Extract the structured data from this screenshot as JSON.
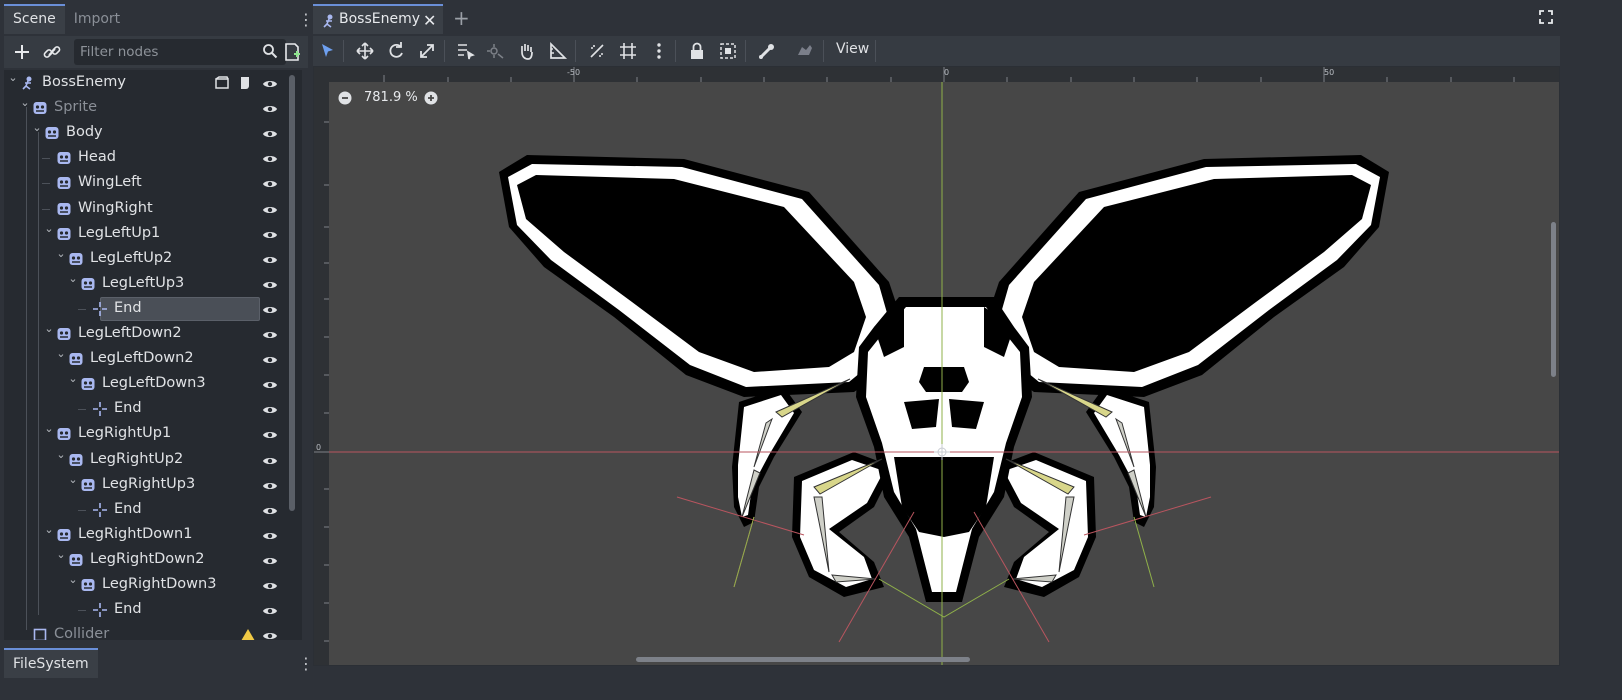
{
  "left_dock": {
    "tabs": [
      {
        "label": "Scene",
        "active": true
      },
      {
        "label": "Import",
        "active": false
      }
    ],
    "toolbar": {
      "add_icon": "plus-icon",
      "link_icon": "link-icon",
      "filter_placeholder": "Filter nodes",
      "search_icon": "search-icon",
      "script_icon": "add-script-icon"
    },
    "tree": [
      {
        "label": "BossEnemy",
        "icon": "skeleton2d-icon",
        "depth": 0,
        "expanded": true,
        "dim": false
      },
      {
        "label": "Sprite",
        "icon": "sprite-icon",
        "depth": 1,
        "expanded": true,
        "dim": true
      },
      {
        "label": "Body",
        "icon": "bone-icon",
        "depth": 2,
        "expanded": true,
        "dim": false
      },
      {
        "label": "Head",
        "icon": "bone-icon",
        "depth": 3,
        "expanded": false,
        "dim": false
      },
      {
        "label": "WingLeft",
        "icon": "bone-icon",
        "depth": 3,
        "expanded": false,
        "dim": false
      },
      {
        "label": "WingRight",
        "icon": "bone-icon",
        "depth": 3,
        "expanded": false,
        "dim": false
      },
      {
        "label": "LegLeftUp1",
        "icon": "bone-icon",
        "depth": 3,
        "expanded": true,
        "dim": false
      },
      {
        "label": "LegLeftUp2",
        "icon": "bone-icon",
        "depth": 4,
        "expanded": true,
        "dim": false
      },
      {
        "label": "LegLeftUp3",
        "icon": "bone-icon",
        "depth": 5,
        "expanded": true,
        "dim": false
      },
      {
        "label": "End",
        "icon": "position2d-icon",
        "depth": 6,
        "expanded": false,
        "dim": false,
        "selected": true
      },
      {
        "label": "LegLeftDown2",
        "icon": "bone-icon",
        "depth": 3,
        "expanded": true,
        "dim": false
      },
      {
        "label": "LegLeftDown2",
        "icon": "bone-icon",
        "depth": 4,
        "expanded": true,
        "dim": false
      },
      {
        "label": "LegLeftDown3",
        "icon": "bone-icon",
        "depth": 5,
        "expanded": true,
        "dim": false
      },
      {
        "label": "End",
        "icon": "position2d-icon",
        "depth": 6,
        "expanded": false,
        "dim": false
      },
      {
        "label": "LegRightUp1",
        "icon": "bone-icon",
        "depth": 3,
        "expanded": true,
        "dim": false
      },
      {
        "label": "LegRightUp2",
        "icon": "bone-icon",
        "depth": 4,
        "expanded": true,
        "dim": false
      },
      {
        "label": "LegRightUp3",
        "icon": "bone-icon",
        "depth": 5,
        "expanded": true,
        "dim": false
      },
      {
        "label": "End",
        "icon": "position2d-icon",
        "depth": 6,
        "expanded": false,
        "dim": false
      },
      {
        "label": "LegRightDown1",
        "icon": "bone-icon",
        "depth": 3,
        "expanded": true,
        "dim": false
      },
      {
        "label": "LegRightDown2",
        "icon": "bone-icon",
        "depth": 4,
        "expanded": true,
        "dim": false
      },
      {
        "label": "LegRightDown3",
        "icon": "bone-icon",
        "depth": 5,
        "expanded": true,
        "dim": false
      },
      {
        "label": "End",
        "icon": "position2d-icon",
        "depth": 6,
        "expanded": false,
        "dim": false
      },
      {
        "label": "Collider",
        "icon": "collision-icon",
        "depth": 1,
        "expanded": false,
        "dim": true,
        "warning": true
      }
    ],
    "bottom_tab": "FileSystem"
  },
  "editor": {
    "scene_tab": "BossEnemy",
    "scene_tab_icon": "skeleton2d-icon",
    "toolbar_icons": [
      "select-icon",
      "move-icon",
      "rotate-icon",
      "scale-icon",
      "list-select-icon",
      "pivot-icon",
      "pan-icon",
      "ruler-icon",
      "smart-snap-icon",
      "grid-snap-icon",
      "more-icon",
      "lock-icon",
      "group-icon",
      "skeleton-icon",
      "bone-tool-icon"
    ],
    "view_menu": "View",
    "zoom": "781.9 %",
    "ruler_labels": [
      "-50",
      "0",
      "50"
    ],
    "ruler_left_labels": [
      "0"
    ]
  },
  "colors": {
    "accent": "#6a8fd8",
    "axis_x": "#b9555f",
    "axis_y": "#8fb04a",
    "bone_fill": "#d8d68a",
    "canvas_bg": "#474747"
  }
}
